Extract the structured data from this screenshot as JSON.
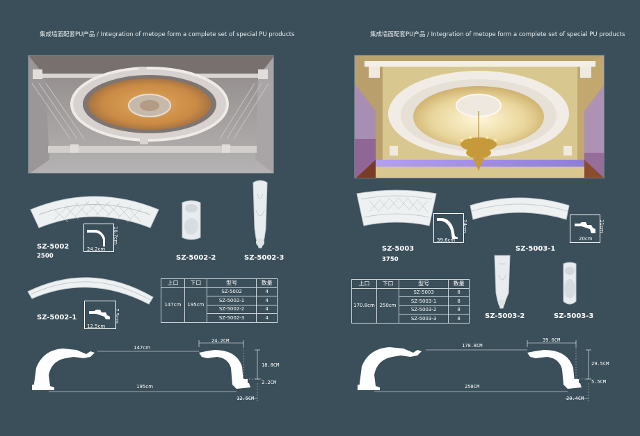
{
  "header": {
    "left": "集成墙面配套PU产品 / Integration of metope form a complete set of special PU products",
    "right": "集成墙面配套PU产品 / Integration of metope form a complete set of special PU products"
  },
  "left": {
    "products": [
      {
        "code": "SZ-5002",
        "sub": "2500",
        "profile_w": "24.2cm",
        "profile_h": "16.7cm"
      },
      {
        "code": "SZ-5002-1",
        "profile_w": "12.5cm",
        "profile_h": "7.5cm"
      },
      {
        "code": "SZ-5002-2"
      },
      {
        "code": "SZ-5002-3"
      }
    ],
    "table": {
      "headers": [
        "上口",
        "下口",
        "型号",
        "数量"
      ],
      "top": "147cm",
      "bottom": "195cm",
      "rows": [
        {
          "model": "SZ-5002",
          "qty": "4"
        },
        {
          "model": "SZ-5002-1",
          "qty": "4"
        },
        {
          "model": "SZ-5002-2",
          "qty": "4"
        },
        {
          "model": "SZ-5002-3",
          "qty": "4"
        }
      ]
    },
    "drawing": {
      "top_span": "147cm",
      "bottom_span": "195cm",
      "width": "24.2CM",
      "height": "18.8CM",
      "foot_h": "2.2CM",
      "foot_w": "12.5CM"
    }
  },
  "right": {
    "products": [
      {
        "code": "SZ-5003",
        "sub": "3750",
        "profile_w": "39.6cm",
        "profile_h": "24cm"
      },
      {
        "code": "SZ-5003-1",
        "profile_w": "20cm",
        "profile_h": "11cm"
      },
      {
        "code": "SZ-5003-2"
      },
      {
        "code": "SZ-5003-3"
      }
    ],
    "table": {
      "headers": [
        "上口",
        "下口",
        "型号",
        "数量"
      ],
      "top": "170.8cm",
      "bottom": "250cm",
      "rows": [
        {
          "model": "SZ-5003",
          "qty": "8"
        },
        {
          "model": "SZ-5003-1",
          "qty": "8"
        },
        {
          "model": "SZ-5003-2",
          "qty": "8"
        },
        {
          "model": "SZ-5003-3",
          "qty": "8"
        }
      ]
    },
    "drawing": {
      "top_span": "170.8CM",
      "bottom_span": "250CM",
      "width": "39.6CM",
      "height": "29.5CM",
      "foot_h": "5.5CM",
      "foot_w": "20.4CM"
    }
  },
  "colors": {
    "background": "#3b4f5a",
    "line": "#ffffff"
  }
}
